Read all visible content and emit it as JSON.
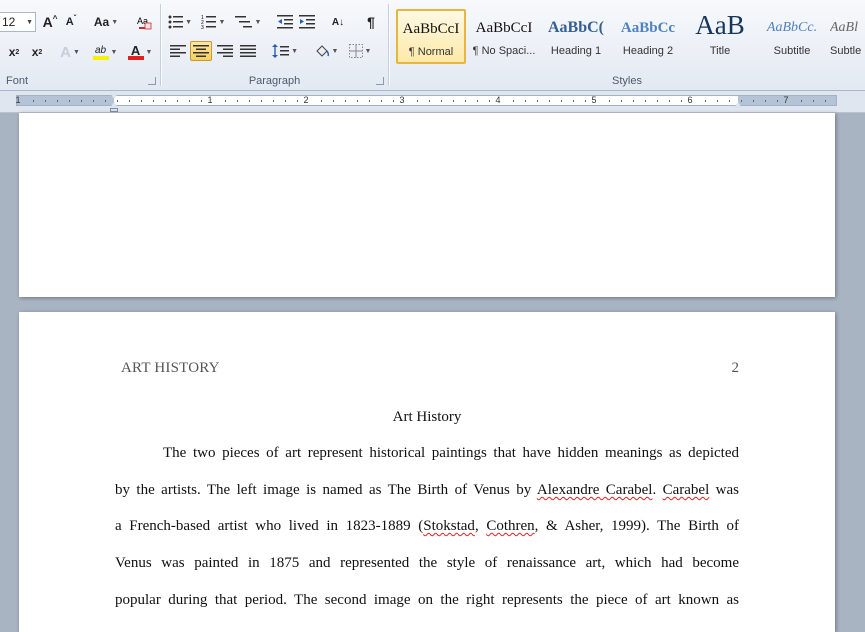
{
  "ribbon": {
    "font_group": {
      "label": "Font",
      "font_size": "12",
      "grow_font": "A",
      "shrink_font": "A",
      "change_case": "Aa",
      "subscript": "x",
      "subscript_mark": "2",
      "superscript": "x",
      "superscript_mark": "2",
      "text_effects": "A",
      "highlight": "ab",
      "font_color": "A",
      "font_color_hex": "#e02020",
      "highlight_hex": "#f7f00a"
    },
    "paragraph_group": {
      "label": "Paragraph",
      "sort": "A↓",
      "pilcrow": "¶"
    },
    "styles_group": {
      "label": "Styles",
      "styles": [
        {
          "sample": "AaBbCcI",
          "name": "¶ Normal"
        },
        {
          "sample": "AaBbCcI",
          "name": "¶ No Spaci..."
        },
        {
          "sample": "AaBbC(",
          "name": "Heading 1"
        },
        {
          "sample": "AaBbCc",
          "name": "Heading 2"
        },
        {
          "sample": "AaB",
          "name": "Title"
        },
        {
          "sample": "AaBbCc.",
          "name": "Subtitle"
        },
        {
          "sample": "AaBl",
          "name": "Subtle"
        }
      ]
    }
  },
  "ruler": {
    "numbers": [
      "1",
      "1",
      "2",
      "3",
      "4",
      "5",
      "6",
      "7"
    ]
  },
  "document": {
    "running_head": "ART HISTORY",
    "page_number": "2",
    "title": "Art History",
    "lines": [
      {
        "parts": [
          "The two pieces of art represent historical paintings that have hidden meanings as depicted"
        ]
      },
      {
        "parts": [
          "by the artists. The left image is named as The Birth of Venus by ",
          "Alexandre Carabel",
          ". ",
          "Carabel",
          " was"
        ]
      },
      {
        "parts": [
          "a French-based artist who lived in 1823-1889 (",
          "Stokstad",
          ", ",
          "Cothren",
          ", & Asher, 1999). The Birth of"
        ]
      },
      {
        "parts": [
          "Venus was painted in 1875 and represented the style of renaissance art, which had become"
        ]
      },
      {
        "parts": [
          "popular during that period. The second image on the right represents the piece of art known as"
        ]
      }
    ]
  }
}
